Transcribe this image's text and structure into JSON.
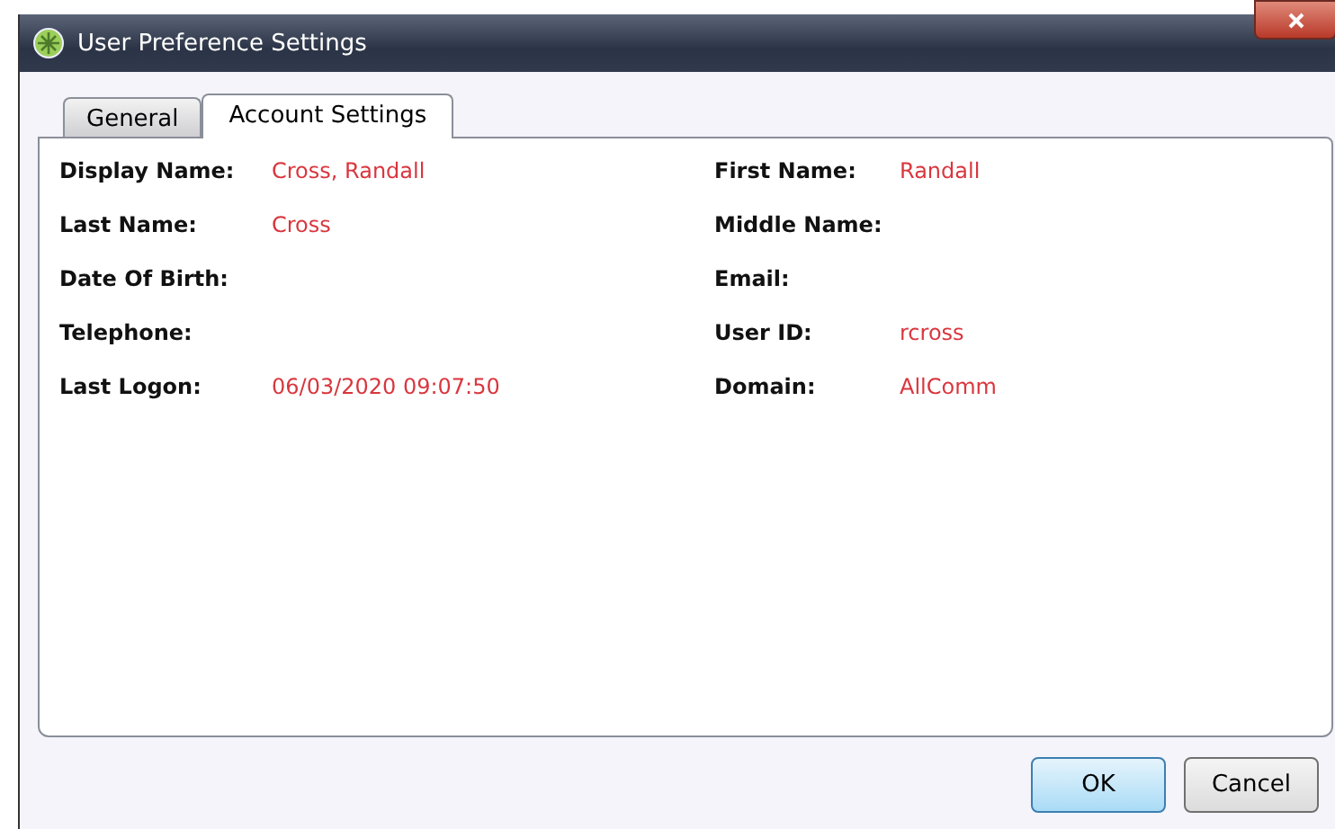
{
  "window": {
    "title": "User Preference Settings"
  },
  "tabs": [
    {
      "label": "General",
      "selected": false
    },
    {
      "label": "Account Settings",
      "selected": true
    }
  ],
  "fields": [
    {
      "label": "Display Name:",
      "value": "Cross, Randall"
    },
    {
      "label": "First Name:",
      "value": "Randall"
    },
    {
      "label": "Last Name:",
      "value": "Cross"
    },
    {
      "label": "Middle Name:"
    },
    {
      "label": "Date Of Birth:"
    },
    {
      "label": "Email:"
    },
    {
      "label": "Telephone:"
    },
    {
      "label": "User ID:",
      "value": "rcross"
    },
    {
      "label": "Last Logon:",
      "value": "06/03/2020 09:07:50"
    },
    {
      "label": "Domain:",
      "value": "AllComm"
    }
  ],
  "buttons": [
    {
      "label": "OK",
      "kind": "default"
    },
    {
      "label": "Cancel",
      "kind": "normal"
    }
  ]
}
